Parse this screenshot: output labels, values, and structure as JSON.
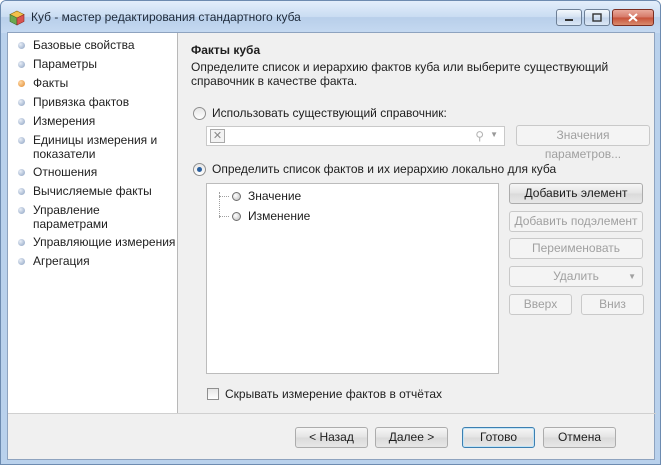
{
  "window": {
    "title": "Куб - мастер редактирования стандартного куба"
  },
  "sidebar": {
    "items": [
      {
        "label": "Базовые свойства",
        "active": false
      },
      {
        "label": "Параметры",
        "active": false
      },
      {
        "label": "Факты",
        "active": true
      },
      {
        "label": "Привязка фактов",
        "active": false
      },
      {
        "label": "Измерения",
        "active": false
      },
      {
        "label": "Единицы измерения и показатели",
        "active": false
      },
      {
        "label": "Отношения",
        "active": false
      },
      {
        "label": "Вычисляемые факты",
        "active": false
      },
      {
        "label": "Управление параметрами",
        "active": false
      },
      {
        "label": "Управляющие измерения",
        "active": false
      },
      {
        "label": "Агрегация",
        "active": false
      }
    ]
  },
  "main": {
    "title": "Факты куба",
    "description": "Определите список и иерархию фактов куба или выберите существующий справочник в качестве факта.",
    "use_existing_label": "Использовать существующий справочник:",
    "param_values_button": "Значения параметров...",
    "define_local_label": "Определить список фактов и их иерархию локально для куба",
    "tree_items": [
      "Значение",
      "Изменение"
    ],
    "buttons": {
      "add_element": "Добавить элемент",
      "add_subelement": "Добавить подэлемент",
      "rename": "Переименовать",
      "delete": "Удалить",
      "up": "Вверх",
      "down": "Вниз"
    },
    "hide_dimension_label": "Скрывать измерение фактов в отчётах"
  },
  "footer": {
    "back": "< Назад",
    "next": "Далее >",
    "finish": "Готово",
    "cancel": "Отмена"
  }
}
